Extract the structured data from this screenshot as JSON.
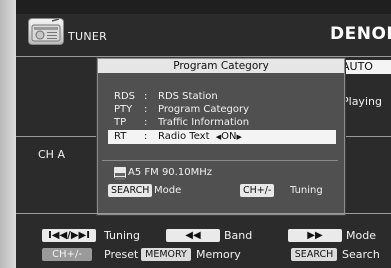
{
  "header": {
    "source_label": "TUNER",
    "brand": "DENON",
    "mode_value": "AUTO",
    "status_text": "Playing",
    "channel_label": "CH A"
  },
  "popup": {
    "title": "Program Category",
    "items": [
      {
        "key": "RDS",
        "sep": ":",
        "value": "RDS Station"
      },
      {
        "key": "PTY",
        "sep": ":",
        "value": "Program Category"
      },
      {
        "key": "TP",
        "sep": ":",
        "value": "Traffic Information"
      },
      {
        "key": "RT",
        "sep": ":",
        "value": "Radio Text",
        "option": "ON"
      }
    ],
    "arrow_left": "◀",
    "arrow_right": "▶",
    "station": "A5 FM 90.10MHz",
    "mode_badge": "SEARCH",
    "mode_text": "Mode",
    "tuning_badge": "CH+/-",
    "tuning_text": "Tuning"
  },
  "legend": [
    {
      "badge": "I◀◀/▶▶I",
      "text": "Tuning"
    },
    {
      "badge": "◀◀",
      "text": "Band"
    },
    {
      "badge": "▶▶",
      "text": "Mode"
    },
    {
      "badge": "CH+/-",
      "text": "Preset"
    },
    {
      "badge": "MEMORY",
      "text": "Memory"
    },
    {
      "badge": "SEARCH",
      "text": "Search"
    }
  ],
  "icons": {
    "tuner": "radio-icon",
    "station": "station-memory-icon"
  }
}
